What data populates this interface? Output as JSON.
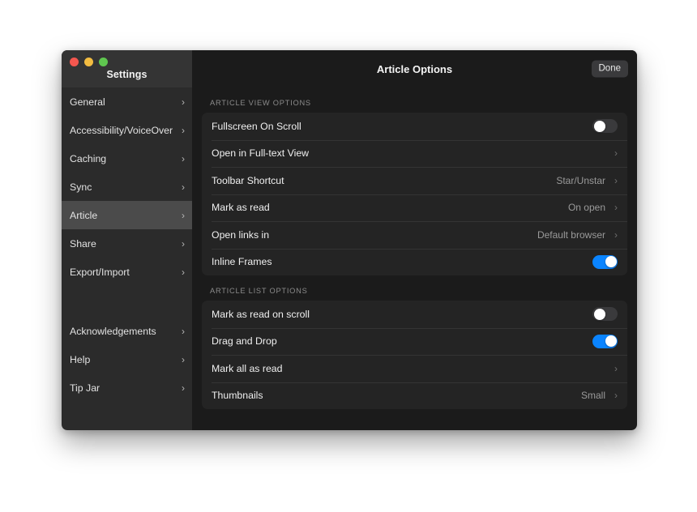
{
  "window": {
    "traffic_lights": [
      "close",
      "minimize",
      "zoom"
    ],
    "colors": {
      "accent_on": "#0A84FF",
      "toggle_off": "#3A3A3C",
      "sidebar_bg": "#2B2B2B",
      "sidebar_selected": "#4B4B4B",
      "main_bg": "#1B1B1B",
      "card_bg": "#242424"
    }
  },
  "sidebar": {
    "title": "Settings",
    "items": [
      {
        "label": "General",
        "selected": false
      },
      {
        "label": "Accessibility/VoiceOver",
        "selected": false
      },
      {
        "label": "Caching",
        "selected": false
      },
      {
        "label": "Sync",
        "selected": false
      },
      {
        "label": "Article",
        "selected": true
      },
      {
        "label": "Share",
        "selected": false
      },
      {
        "label": "Export/Import",
        "selected": false
      }
    ],
    "items_bottom": [
      {
        "label": "Acknowledgements"
      },
      {
        "label": "Help"
      },
      {
        "label": "Tip Jar"
      }
    ]
  },
  "header": {
    "title": "Article Options",
    "done_label": "Done"
  },
  "sections": [
    {
      "title": "ARTICLE VIEW OPTIONS",
      "rows": [
        {
          "label": "Fullscreen On Scroll",
          "type": "toggle",
          "on": false
        },
        {
          "label": "Open in Full-text View",
          "type": "disclosure",
          "value": ""
        },
        {
          "label": "Toolbar Shortcut",
          "type": "disclosure",
          "value": "Star/Unstar"
        },
        {
          "label": "Mark as read",
          "type": "disclosure",
          "value": "On open"
        },
        {
          "label": "Open links in",
          "type": "disclosure",
          "value": "Default browser"
        },
        {
          "label": "Inline Frames",
          "type": "toggle",
          "on": true
        }
      ]
    },
    {
      "title": "ARTICLE LIST OPTIONS",
      "rows": [
        {
          "label": "Mark as read on scroll",
          "type": "toggle",
          "on": false
        },
        {
          "label": "Drag and Drop",
          "type": "toggle",
          "on": true
        },
        {
          "label": "Mark all as read",
          "type": "disclosure",
          "value": ""
        },
        {
          "label": "Thumbnails",
          "type": "disclosure",
          "value": "Small"
        }
      ]
    }
  ]
}
